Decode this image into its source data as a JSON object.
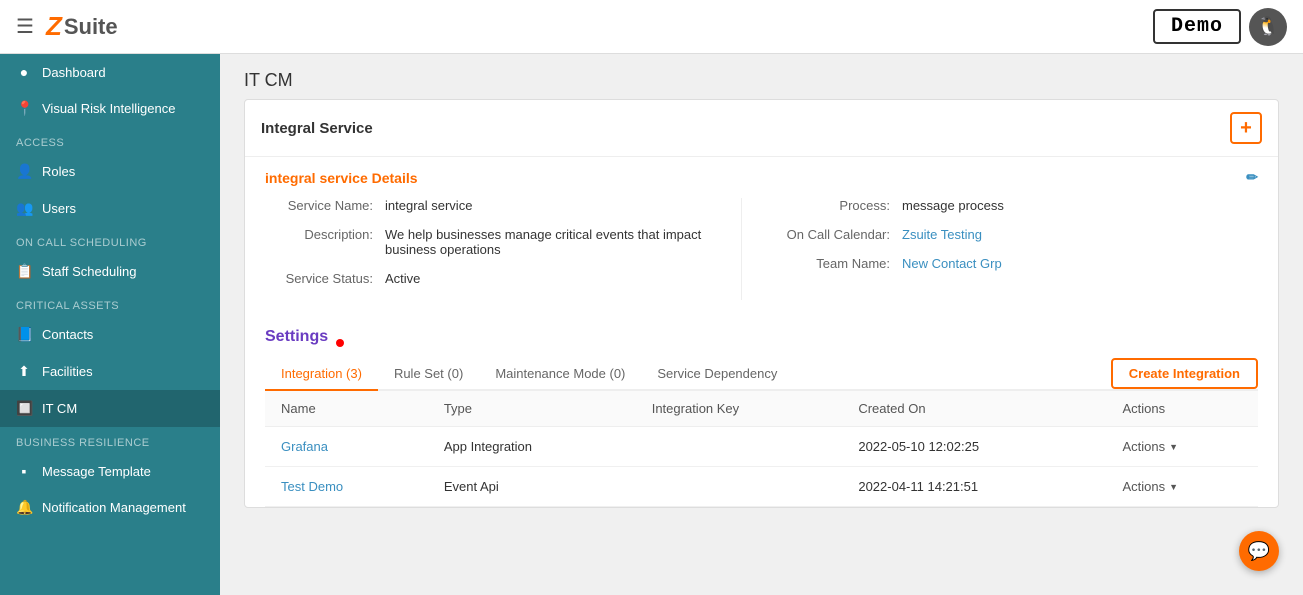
{
  "topbar": {
    "menu_label": "☰",
    "logo_z": "Z",
    "logo_suite": "Suite",
    "demo_label": "Demo",
    "user_icon": "🐧"
  },
  "sidebar": {
    "sections": [
      {
        "label": "",
        "items": [
          {
            "id": "dashboard",
            "icon": "●",
            "label": "Dashboard"
          },
          {
            "id": "visual-risk",
            "icon": "📍",
            "label": "Visual Risk Intelligence"
          }
        ]
      },
      {
        "label": "ACCESS",
        "items": [
          {
            "id": "roles",
            "icon": "👤",
            "label": "Roles"
          },
          {
            "id": "users",
            "icon": "👥",
            "label": "Users"
          }
        ]
      },
      {
        "label": "ON CALL SCHEDULING",
        "items": [
          {
            "id": "staff-scheduling",
            "icon": "📋",
            "label": "Staff Scheduling"
          }
        ]
      },
      {
        "label": "CRITICAL ASSETS",
        "items": [
          {
            "id": "contacts",
            "icon": "📘",
            "label": "Contacts"
          },
          {
            "id": "facilities",
            "icon": "⬆",
            "label": "Facilities"
          },
          {
            "id": "itcm",
            "icon": "🔲",
            "label": "IT CM",
            "active": true
          }
        ]
      },
      {
        "label": "BUSINESS RESILIENCE",
        "items": [
          {
            "id": "message-template",
            "icon": "▪",
            "label": "Message Template"
          },
          {
            "id": "notification-mgmt",
            "icon": "🔔",
            "label": "Notification Management"
          }
        ]
      }
    ]
  },
  "page": {
    "title": "IT CM",
    "card_title": "Integral Service",
    "details_section_title": "integral service Details",
    "fields": {
      "service_name_label": "Service Name:",
      "service_name_value": "integral service",
      "description_label": "Description:",
      "description_value": "We help businesses manage critical events that impact business operations",
      "service_status_label": "Service Status:",
      "service_status_value": "Active",
      "process_label": "Process:",
      "process_value": "message process",
      "on_call_calendar_label": "On Call Calendar:",
      "on_call_calendar_value": "Zsuite Testing",
      "team_name_label": "Team Name:",
      "team_name_value": "New Contact Grp"
    },
    "settings": {
      "title": "Settings",
      "tabs": [
        {
          "id": "integration",
          "label": "Integration (3)",
          "active": true
        },
        {
          "id": "rule-set",
          "label": "Rule Set (0)",
          "active": false
        },
        {
          "id": "maintenance-mode",
          "label": "Maintenance Mode (0)",
          "active": false
        },
        {
          "id": "service-dependency",
          "label": "Service Dependency",
          "active": false
        }
      ],
      "create_integration_label": "Create Integration",
      "table": {
        "columns": [
          {
            "id": "name",
            "label": "Name"
          },
          {
            "id": "type",
            "label": "Type"
          },
          {
            "id": "integration-key",
            "label": "Integration Key"
          },
          {
            "id": "created-on",
            "label": "Created On"
          },
          {
            "id": "actions",
            "label": "Actions"
          }
        ],
        "rows": [
          {
            "name": "Grafana",
            "type": "App Integration",
            "integration_key": "",
            "created_on": "2022-05-10 12:02:25",
            "actions": "Actions"
          },
          {
            "name": "Test Demo",
            "type": "Event Api",
            "integration_key": "",
            "created_on": "2022-04-11 14:21:51",
            "actions": "Actions"
          }
        ]
      }
    }
  },
  "chat": {
    "icon": "💬"
  }
}
